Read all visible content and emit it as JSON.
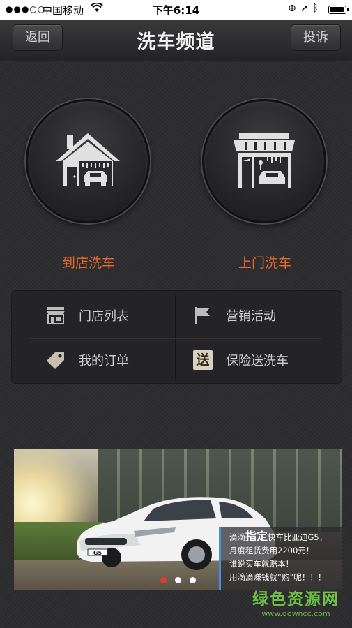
{
  "status_bar": {
    "signal": "●●●○○",
    "carrier": "中国移动",
    "time": "下午6:14"
  },
  "nav": {
    "back_label": "返回",
    "title": "洗车频道",
    "report_label": "投诉"
  },
  "services": [
    {
      "label": "到店洗车",
      "icon": "house-carwash-icon"
    },
    {
      "label": "上门洗车",
      "icon": "storefront-carwash-icon"
    }
  ],
  "menu": {
    "stores": {
      "label": "门店列表",
      "icon": "store-icon"
    },
    "marketing": {
      "label": "营销活动",
      "icon": "flag-icon"
    },
    "orders": {
      "label": "我的订单",
      "icon": "tag-icon"
    },
    "insurance": {
      "label": "保险送洗车",
      "icon_text": "送"
    }
  },
  "banner": {
    "caption": {
      "prefix": "滴滴",
      "emphasis": "指定",
      "line1_rest": "快车比亚迪G5，",
      "line2": "月度租赁费用2200元！",
      "line3": "谁说买车就赔本！",
      "line4": "用滴滴赚钱就“购”呢！！！"
    },
    "car_plate": "G5",
    "slides_total": 3,
    "active_slide": 0
  },
  "colors": {
    "accent_orange": "#e8692d",
    "watermark_green": "#6ec046",
    "dot_active": "#e03a2c"
  },
  "watermark": {
    "main": "绿色资源网",
    "url": "www.downcc.com"
  }
}
